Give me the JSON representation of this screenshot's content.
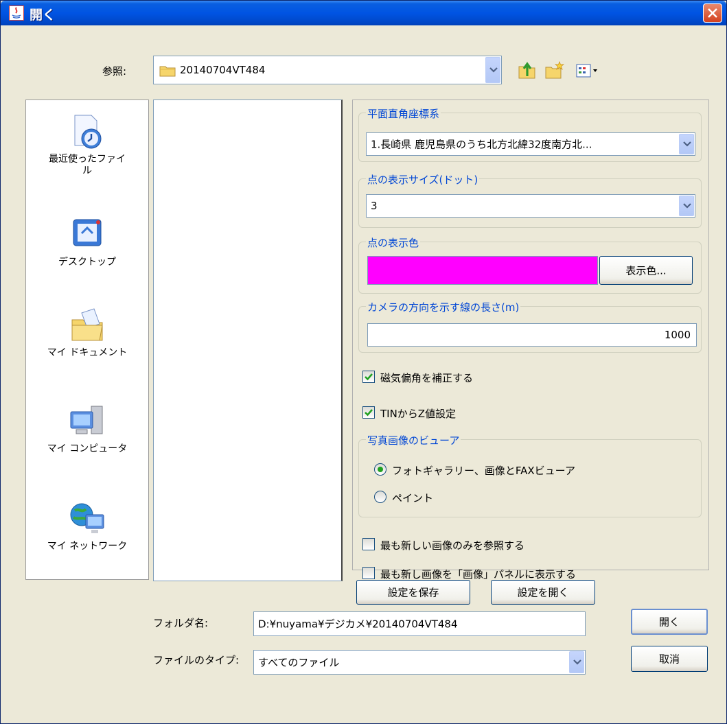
{
  "window": {
    "title": "開く",
    "colors": {
      "titlebar": "#0054E3",
      "body": "#ECE9D8",
      "close": "#D4411E"
    }
  },
  "lookin": {
    "label": "参照:",
    "folder": "20140704VT484",
    "toolbar_icons": [
      "up-folder-icon",
      "new-folder-icon",
      "view-menu-icon"
    ]
  },
  "places": [
    {
      "label": "最近使ったファイル",
      "icon": "recent-files-icon"
    },
    {
      "label": "デスクトップ",
      "icon": "desktop-icon"
    },
    {
      "label": "マイ ドキュメント",
      "icon": "my-documents-icon"
    },
    {
      "label": "マイ コンピュータ",
      "icon": "my-computer-icon"
    },
    {
      "label": "マイ ネットワーク",
      "icon": "my-network-icon"
    }
  ],
  "accessory": {
    "coord": {
      "title": "平面直角座標系",
      "value": "1.長崎県 鹿児島県のうち北方北緯32度南方北..."
    },
    "point_size": {
      "title": "点の表示サイズ(ドット)",
      "value": "3"
    },
    "point_color": {
      "title": "点の表示色",
      "swatch": "#FF00FF",
      "button": "表示色..."
    },
    "line_length": {
      "title": "カメラの方向を示す線の長さ(m)",
      "value": "1000"
    },
    "magnetic": {
      "label": "磁気偏角を補正する",
      "checked": true
    },
    "tin": {
      "label": "TINからZ値設定",
      "checked": true
    },
    "viewer": {
      "title": "写真画像のビューア",
      "options": [
        {
          "label": "フォトギャラリー、画像とFAXビューア",
          "selected": true
        },
        {
          "label": "ペイント",
          "selected": false
        }
      ]
    },
    "latest_only": {
      "label": "最も新しい画像のみを参照する",
      "checked": false
    },
    "latest_panel": {
      "label": "最も新し画像を「画像」パネルに表示する",
      "checked": false
    },
    "save_button": "設定を保存",
    "open_settings_button": "設定を開く"
  },
  "bottom": {
    "folder_label": "フォルダ名:",
    "folder_value": "D:¥nuyama¥デジカメ¥20140704VT484",
    "type_label": "ファイルのタイプ:",
    "type_value": "すべてのファイル",
    "open_button": "開く",
    "cancel_button": "取消"
  }
}
